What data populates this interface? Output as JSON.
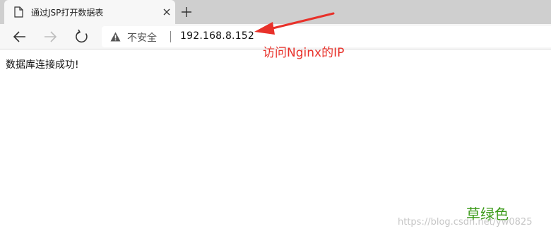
{
  "tab": {
    "title": "通过JSP打开数据表",
    "icon": "page-icon",
    "close_icon": "close-icon"
  },
  "new_tab_icon": "plus-icon",
  "toolbar": {
    "back_icon": "back-arrow-icon",
    "forward_icon": "forward-arrow-icon",
    "reload_icon": "reload-icon"
  },
  "address_bar": {
    "security_icon": "warning-triangle-icon",
    "security_label": "不安全",
    "url": "192.168.8.152"
  },
  "page": {
    "message": "数据库连接成功!"
  },
  "annotation": {
    "text": "访问Nginx的IP",
    "color": "#e8312a"
  },
  "overlay": {
    "green_label": "草绿色",
    "green_color": "#3a9a18",
    "watermark": "https://blog.csdn.net/yw0825"
  }
}
